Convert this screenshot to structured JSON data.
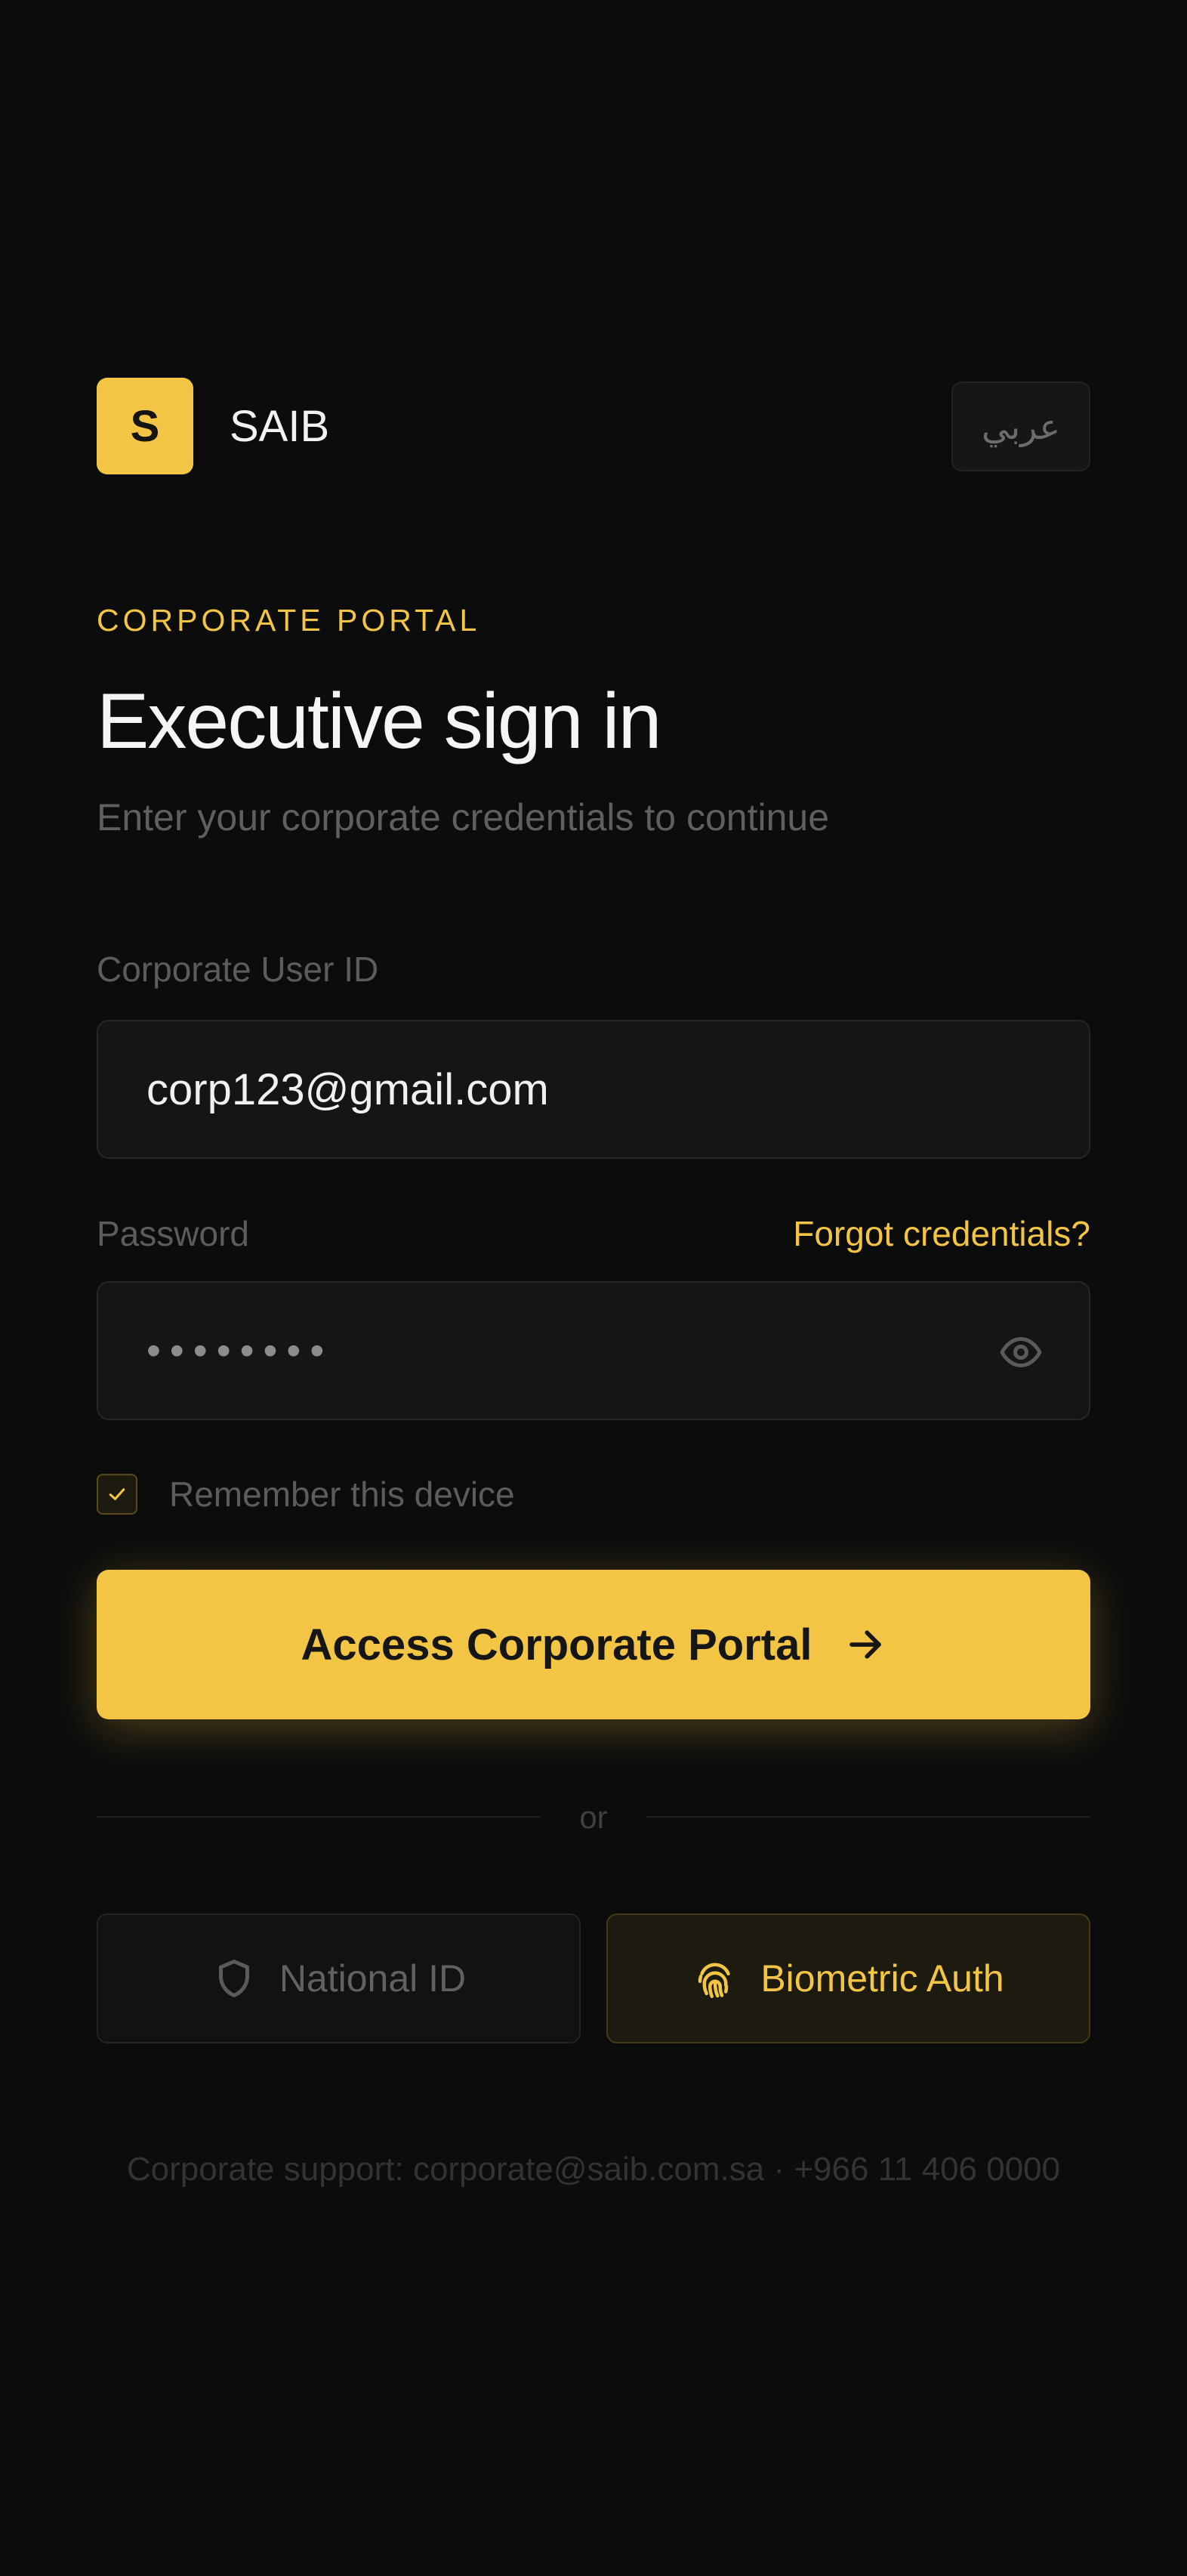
{
  "header": {
    "logo_letter": "S",
    "brand_name": "SAIB",
    "language_toggle": "عربي"
  },
  "intro": {
    "eyebrow": "CORPORATE PORTAL",
    "title": "Executive sign in",
    "subtitle": "Enter your corporate credentials to continue"
  },
  "form": {
    "user_label": "Corporate User ID",
    "user_value": "corp123@gmail.com",
    "password_label": "Password",
    "password_value": "••••••••",
    "forgot_link": "Forgot credentials?",
    "remember_label": "Remember this device",
    "remember_checked": true,
    "submit_label": "Access Corporate Portal"
  },
  "divider_text": "or",
  "alt_auth": {
    "national_id": "National ID",
    "biometric": "Biometric Auth"
  },
  "footer": {
    "support_text": "Corporate support: corporate@saib.com.sa · +966 11 406 0000"
  },
  "colors": {
    "background": "#0c0c0c",
    "accent": "#f3c545",
    "field_background": "#151515"
  },
  "icons": {
    "password_toggle": "eye-icon",
    "remember": "check-icon",
    "submit": "arrow-right-icon",
    "national_id": "shield-icon",
    "biometric": "fingerprint-icon"
  }
}
